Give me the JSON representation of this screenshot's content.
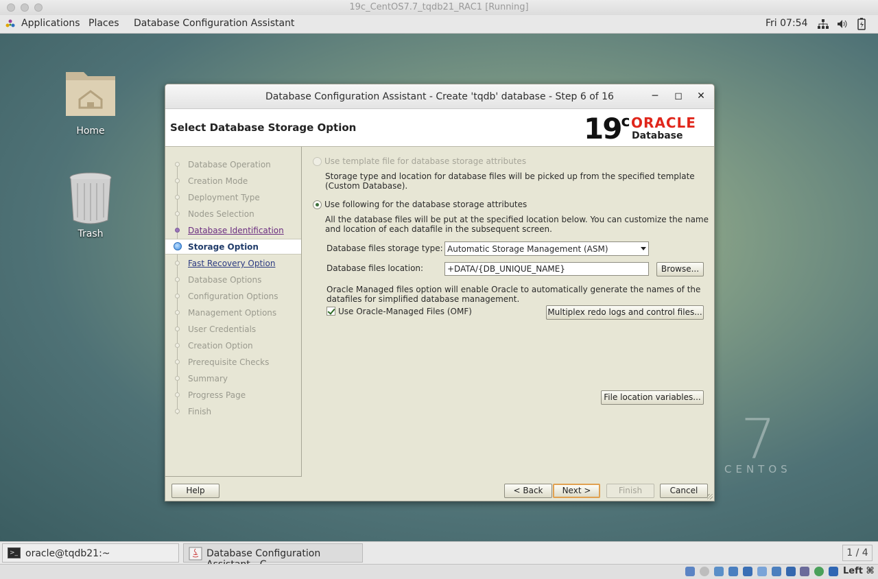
{
  "vbox": {
    "window_title": "19c_CentOS7.7_tqdb21_RAC1 [Running]",
    "host_key": "Left ⌘"
  },
  "topbar": {
    "applications": "Applications",
    "places": "Places",
    "active_app": "Database Configuration Assistant",
    "clock": "Fri 07:54"
  },
  "desktop": {
    "home": "Home",
    "trash": "Trash",
    "centos_version": "7",
    "centos_name": "CENTOS"
  },
  "dialog": {
    "title": "Database Configuration Assistant - Create 'tqdb' database - Step 6 of 16",
    "header": "Select Database Storage Option",
    "logo": {
      "version": "19",
      "version_sup": "c",
      "brand": "ORACLE",
      "product": "Database"
    },
    "steps": [
      {
        "label": "Database Operation",
        "state": "disabled"
      },
      {
        "label": "Creation Mode",
        "state": "disabled"
      },
      {
        "label": "Deployment Type",
        "state": "disabled"
      },
      {
        "label": "Nodes Selection",
        "state": "disabled"
      },
      {
        "label": "Database Identification",
        "state": "visited"
      },
      {
        "label": "Storage Option",
        "state": "active"
      },
      {
        "label": "Fast Recovery Option",
        "state": "link"
      },
      {
        "label": "Database Options",
        "state": "disabled"
      },
      {
        "label": "Configuration Options",
        "state": "disabled"
      },
      {
        "label": "Management Options",
        "state": "disabled"
      },
      {
        "label": "User Credentials",
        "state": "disabled"
      },
      {
        "label": "Creation Option",
        "state": "disabled"
      },
      {
        "label": "Prerequisite Checks",
        "state": "disabled"
      },
      {
        "label": "Summary",
        "state": "disabled"
      },
      {
        "label": "Progress Page",
        "state": "disabled"
      },
      {
        "label": "Finish",
        "state": "disabled"
      }
    ],
    "opt_template": "Use template file for database storage attributes",
    "opt_template_desc1": "Storage type and location for database files will be picked up from the specified template",
    "opt_template_desc2": "(Custom Database).",
    "opt_following": "Use following for the database storage attributes",
    "opt_following_desc1": "All the database files will be put at the specified location below. You can customize the name",
    "opt_following_desc2": "and location of each datafile in the subsequent screen.",
    "storage_type_label": "Database files storage type:",
    "storage_type_value": "Automatic Storage Management (ASM)",
    "location_label": "Database files location:",
    "location_value": "+DATA/{DB_UNIQUE_NAME}",
    "browse": "Browse...",
    "omf_desc1": "Oracle Managed files option will enable Oracle to automatically generate the names of the",
    "omf_desc2": "datafiles for simplified database management.",
    "omf_label": "Use Oracle-Managed Files (OMF)",
    "multiplex": "Multiplex redo logs and control files...",
    "file_vars": "File location variables...",
    "help": "Help",
    "back": "< Back",
    "next": "Next >",
    "finish": "Finish",
    "cancel": "Cancel"
  },
  "taskbar": {
    "terminal": "oracle@tqdb21:~",
    "dbca": "Database Configuration Assistant - C...",
    "pager": "1 / 4"
  },
  "colors": {
    "oracle_red": "#e0261b",
    "dialog_bg": "#e7e6d5"
  }
}
